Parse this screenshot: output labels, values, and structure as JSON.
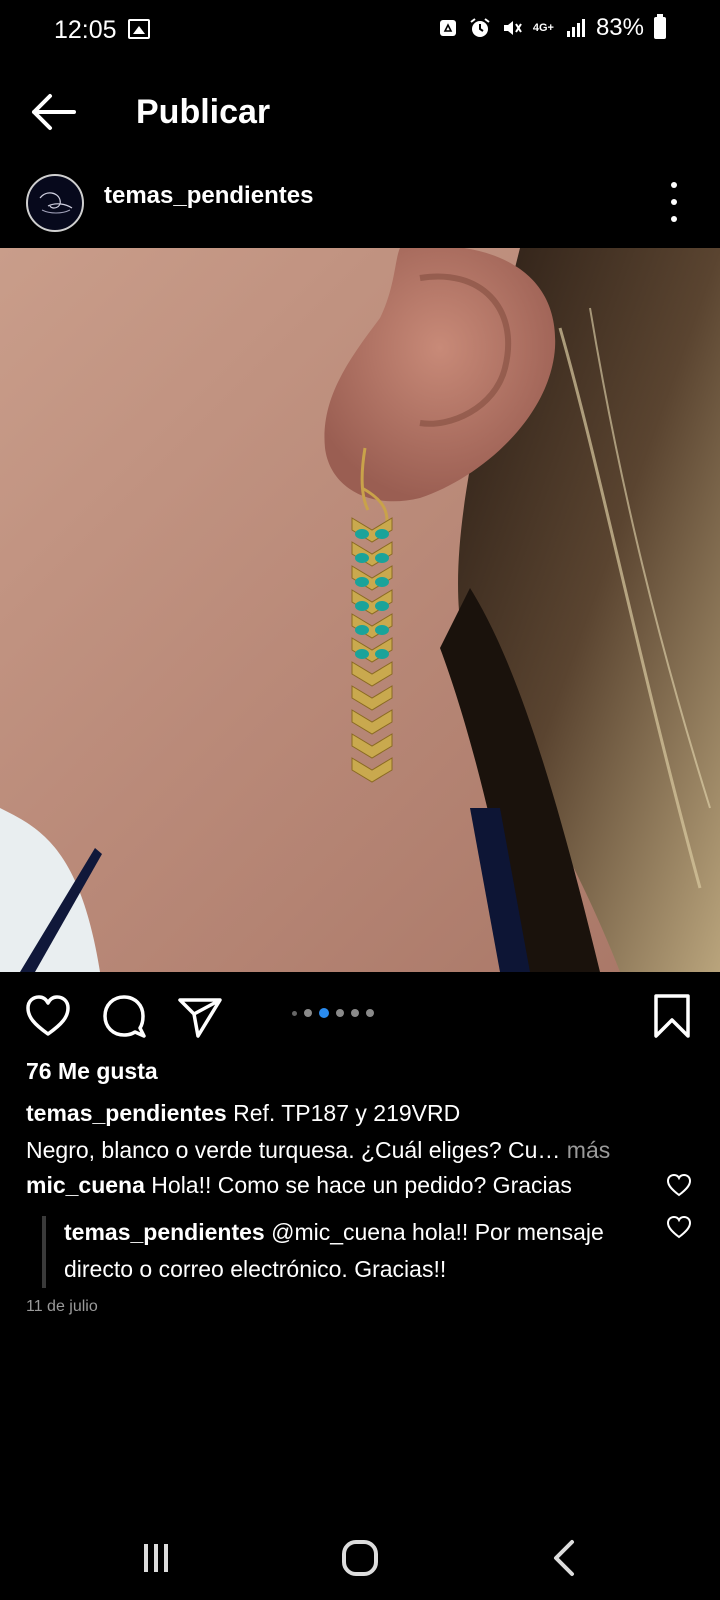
{
  "status_bar": {
    "time": "12:05",
    "battery": "83%",
    "network": "4G+",
    "icons": [
      "image-icon",
      "recycle-icon",
      "alarm-icon",
      "mute-icon",
      "signal-icon",
      "battery-icon"
    ]
  },
  "app_bar": {
    "title": "Publicar",
    "back_icon": "back-arrow-icon"
  },
  "post": {
    "username": "temas_pendientes",
    "more_icon": "more-vertical-icon",
    "carousel": {
      "count": 7,
      "active_index": 2
    },
    "likes": "76 Me gusta",
    "caption": {
      "username": "temas_pendientes",
      "text_line1": "Ref. TP187 y 219VRD",
      "text_line2": "Negro, blanco o verde turquesa. ¿Cuál eliges? Cu…",
      "more": " más"
    },
    "comments": [
      {
        "username": "mic_cuena",
        "text": "Hola!! Como se hace un pedido? Gracias"
      }
    ],
    "reply": {
      "username": "temas_pendientes",
      "text": "@mic_cuena hola!! Por mensaje directo o correo electrónico. Gracias!!"
    },
    "date": "11 de julio"
  },
  "colors": {
    "background": "#000000",
    "accent": "#2a8cf0",
    "muted": "#9a9a9a"
  }
}
